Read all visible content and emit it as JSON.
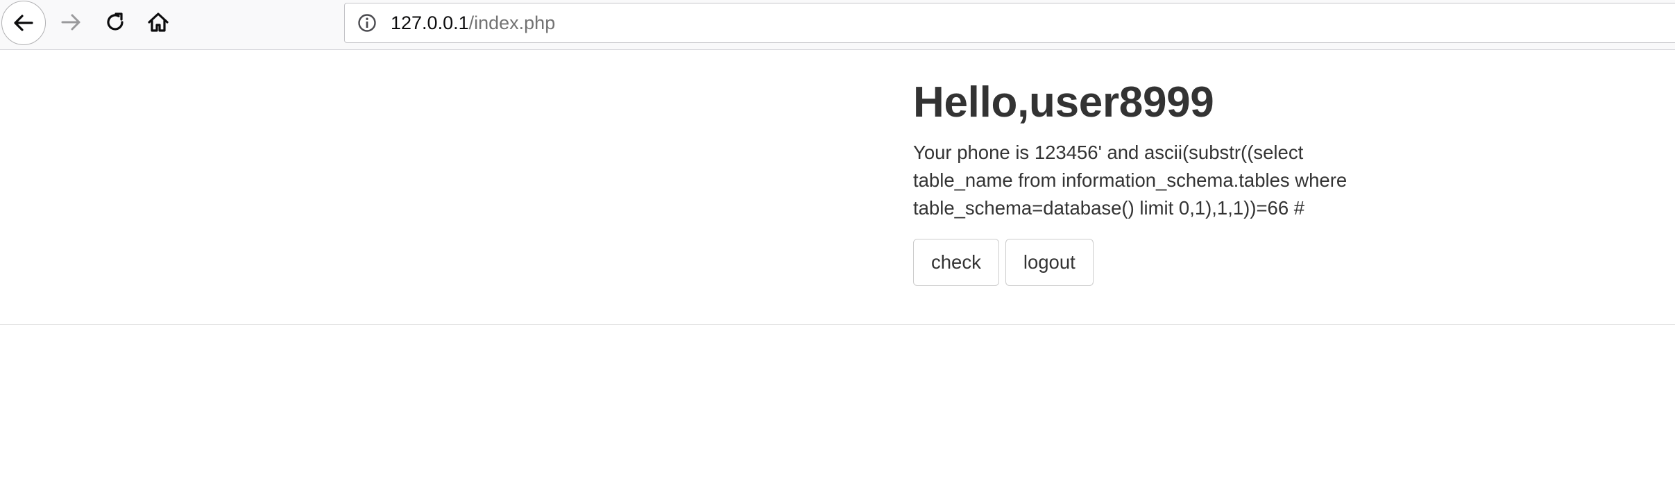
{
  "browser": {
    "url_host": "127.0.0.1",
    "url_path": "/index.php",
    "icons": {
      "back": "arrow-left-icon",
      "forward": "arrow-right-icon",
      "reload": "reload-icon",
      "home": "home-icon",
      "info": "info-icon"
    }
  },
  "page": {
    "greeting": "Hello,user8999",
    "phone_text": "Your phone is 123456' and ascii(substr((select table_name from information_schema.tables where table_schema=database() limit 0,1),1,1))=66 #",
    "buttons": {
      "check_label": "check",
      "logout_label": "logout"
    }
  },
  "colors": {
    "text": "#333333",
    "toolbar_bg": "#f9f9fa",
    "button_border": "#cccccc"
  }
}
